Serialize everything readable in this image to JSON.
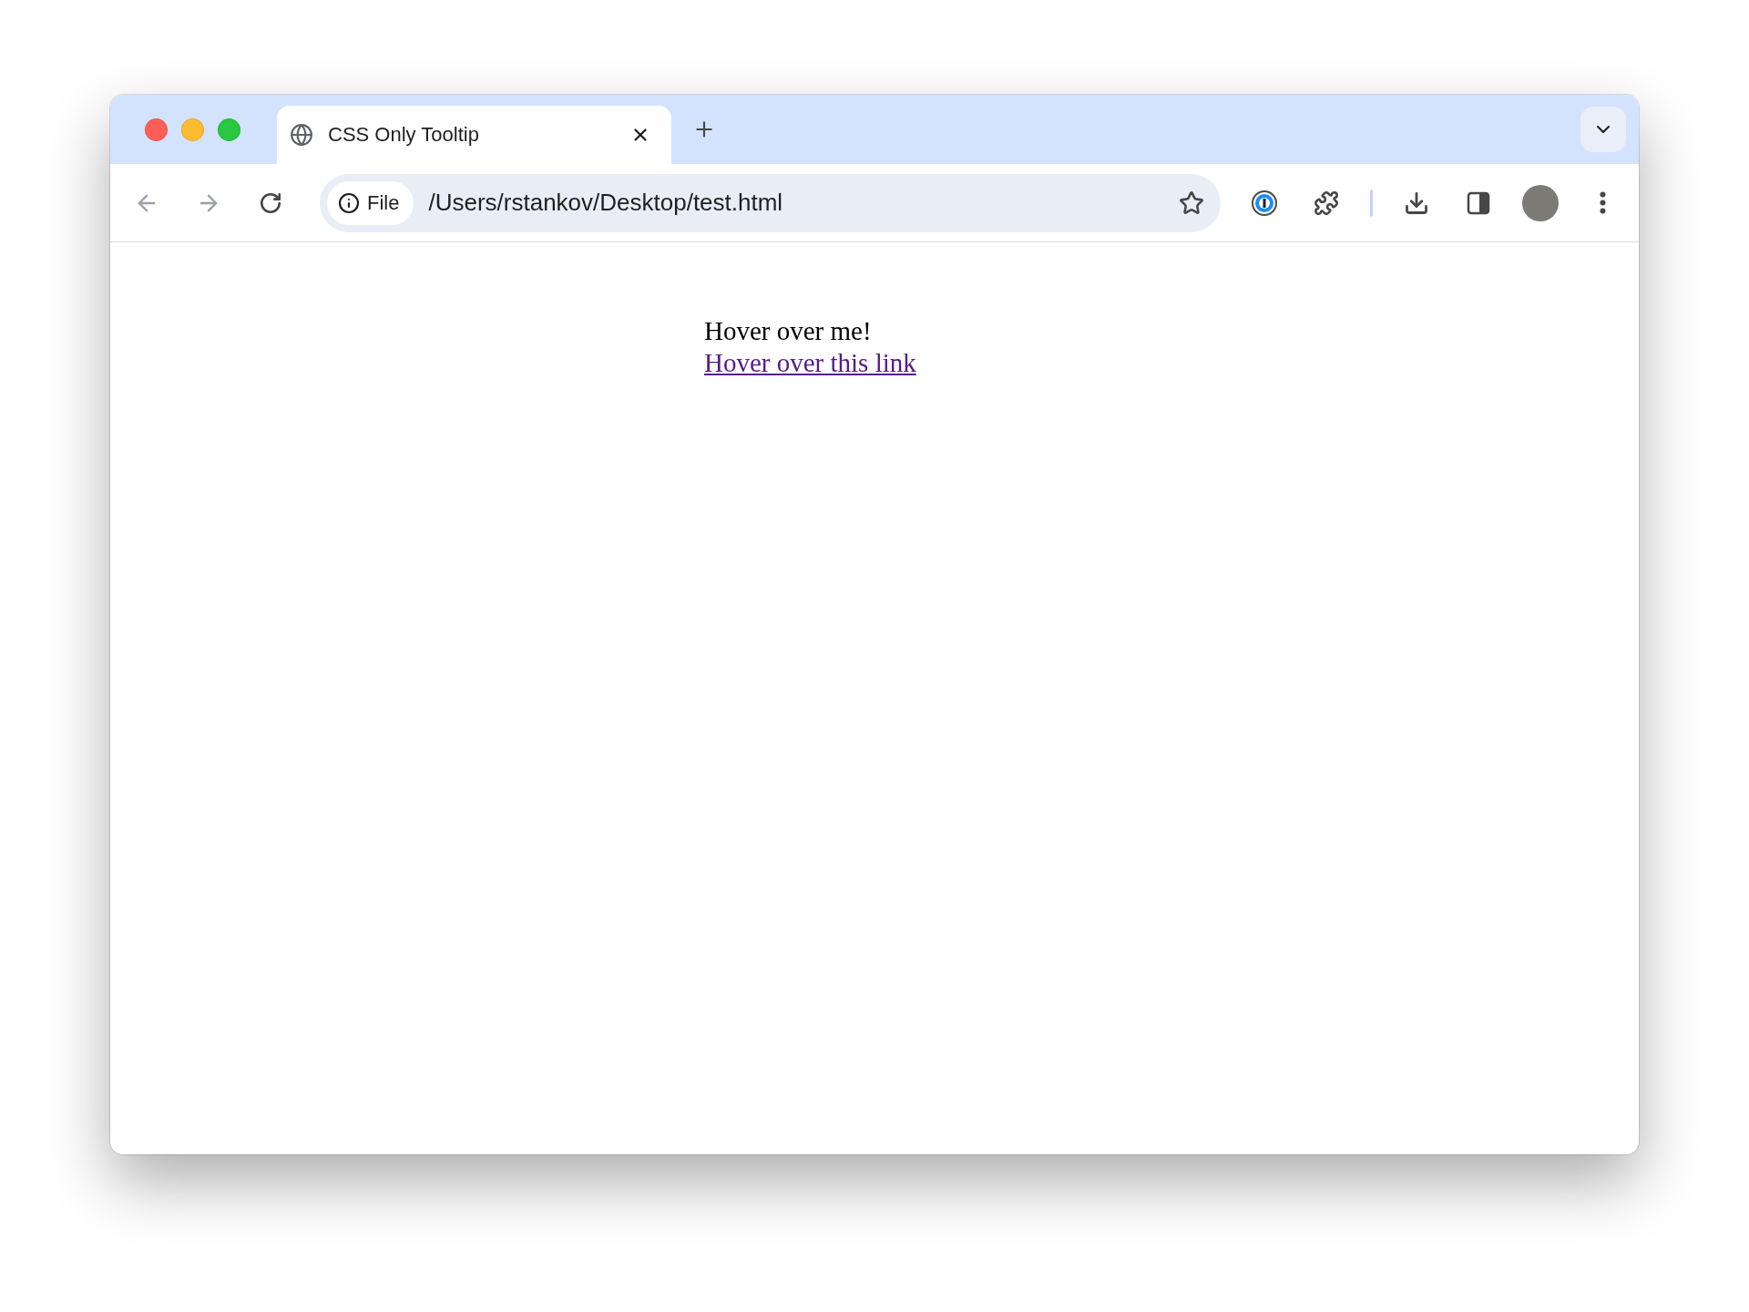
{
  "tab": {
    "title": "CSS Only Tooltip",
    "selected": true
  },
  "address_bar": {
    "chip": "File",
    "url": "/Users/rstankov/Desktop/test.html"
  },
  "page": {
    "text": "Hover over me!",
    "link": "Hover over this link"
  }
}
